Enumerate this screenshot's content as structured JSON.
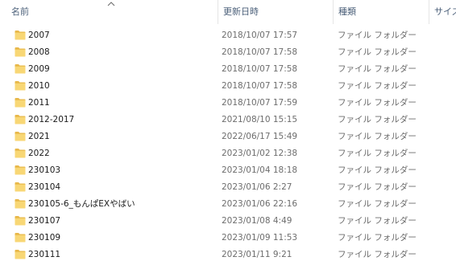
{
  "columns": {
    "name": "名前",
    "date": "更新日時",
    "type": "種類",
    "size": "サイズ"
  },
  "sort": {
    "column": "name",
    "direction": "ascending",
    "icon": "chevron-up-icon"
  },
  "folder_color": "#f8d775",
  "rows": [
    {
      "name": "2007",
      "date": "2018/10/07 17:57",
      "type": "ファイル フォルダー"
    },
    {
      "name": "2008",
      "date": "2018/10/07 17:58",
      "type": "ファイル フォルダー"
    },
    {
      "name": "2009",
      "date": "2018/10/07 17:58",
      "type": "ファイル フォルダー"
    },
    {
      "name": "2010",
      "date": "2018/10/07 17:58",
      "type": "ファイル フォルダー"
    },
    {
      "name": "2011",
      "date": "2018/10/07 17:59",
      "type": "ファイル フォルダー"
    },
    {
      "name": "2012-2017",
      "date": "2021/08/10 15:15",
      "type": "ファイル フォルダー"
    },
    {
      "name": "2021",
      "date": "2022/06/17 15:49",
      "type": "ファイル フォルダー"
    },
    {
      "name": "2022",
      "date": "2023/01/02 12:38",
      "type": "ファイル フォルダー"
    },
    {
      "name": "230103",
      "date": "2023/01/04 18:18",
      "type": "ファイル フォルダー"
    },
    {
      "name": "230104",
      "date": "2023/01/06 2:27",
      "type": "ファイル フォルダー"
    },
    {
      "name": "230105-6_もんぱEXやばい",
      "date": "2023/01/06 22:16",
      "type": "ファイル フォルダー"
    },
    {
      "name": "230107",
      "date": "2023/01/08 4:49",
      "type": "ファイル フォルダー"
    },
    {
      "name": "230109",
      "date": "2023/01/09 11:53",
      "type": "ファイル フォルダー"
    },
    {
      "name": "230111",
      "date": "2023/01/11 9:21",
      "type": "ファイル フォルダー"
    }
  ]
}
